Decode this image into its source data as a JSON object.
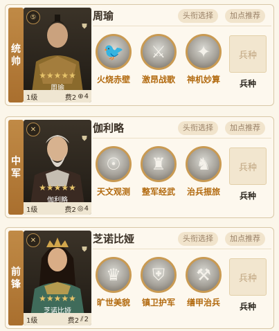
{
  "cards": [
    {
      "position": [
        "统",
        "帅"
      ],
      "badge": "⑤",
      "stars": "★★★★★",
      "general": "周瑜",
      "level": "1级",
      "cost": "费2",
      "range_icon": "range-icon",
      "range": "4",
      "title_button": "头衔选择",
      "points_button": "加点推荐",
      "skills": [
        {
          "name": "火烧赤壁",
          "icon": "phoenix-icon"
        },
        {
          "name": "激昂战歌",
          "icon": "warrior-icon"
        },
        {
          "name": "神机妙算",
          "icon": "burst-icon"
        }
      ],
      "troop_box": "兵种",
      "troop_label": "兵种",
      "palette": {
        "robe": "#8a6a2c",
        "face": "#caa27e",
        "hair": "#1b1610"
      }
    },
    {
      "position": [
        "中",
        "军"
      ],
      "badge": "✕",
      "stars": "★★★★★",
      "general": "伽利略",
      "level": "1级",
      "cost": "费2",
      "range_icon": "target-icon",
      "range": "4",
      "title_button": "头衔选择",
      "points_button": "加点推荐",
      "skills": [
        {
          "name": "天文观测",
          "icon": "scholar-icon"
        },
        {
          "name": "整军经武",
          "icon": "soldiers-icon"
        },
        {
          "name": "治兵振旅",
          "icon": "knights-icon"
        }
      ],
      "troop_box": "兵种",
      "troop_label": "兵种",
      "palette": {
        "robe": "#3a2a22",
        "face": "#d7b28f",
        "hair": "#dcd6cc"
      }
    },
    {
      "position": [
        "前",
        "锋"
      ],
      "badge": "✕",
      "stars": "★★★★★",
      "general": "芝诺比娅",
      "level": "1级",
      "cost": "费2",
      "range_icon": "arrows-icon",
      "range": "2",
      "title_button": "头衔选择",
      "points_button": "加点推荐",
      "skills": [
        {
          "name": "旷世美貌",
          "icon": "queen-icon"
        },
        {
          "name": "镇卫护军",
          "icon": "guard-icon"
        },
        {
          "name": "缮甲治兵",
          "icon": "hammer-icon"
        }
      ],
      "troop_box": "兵种",
      "troop_label": "兵种",
      "palette": {
        "robe": "#3f6b5a",
        "face": "#d9ad86",
        "hair": "#1e130c"
      }
    }
  ]
}
